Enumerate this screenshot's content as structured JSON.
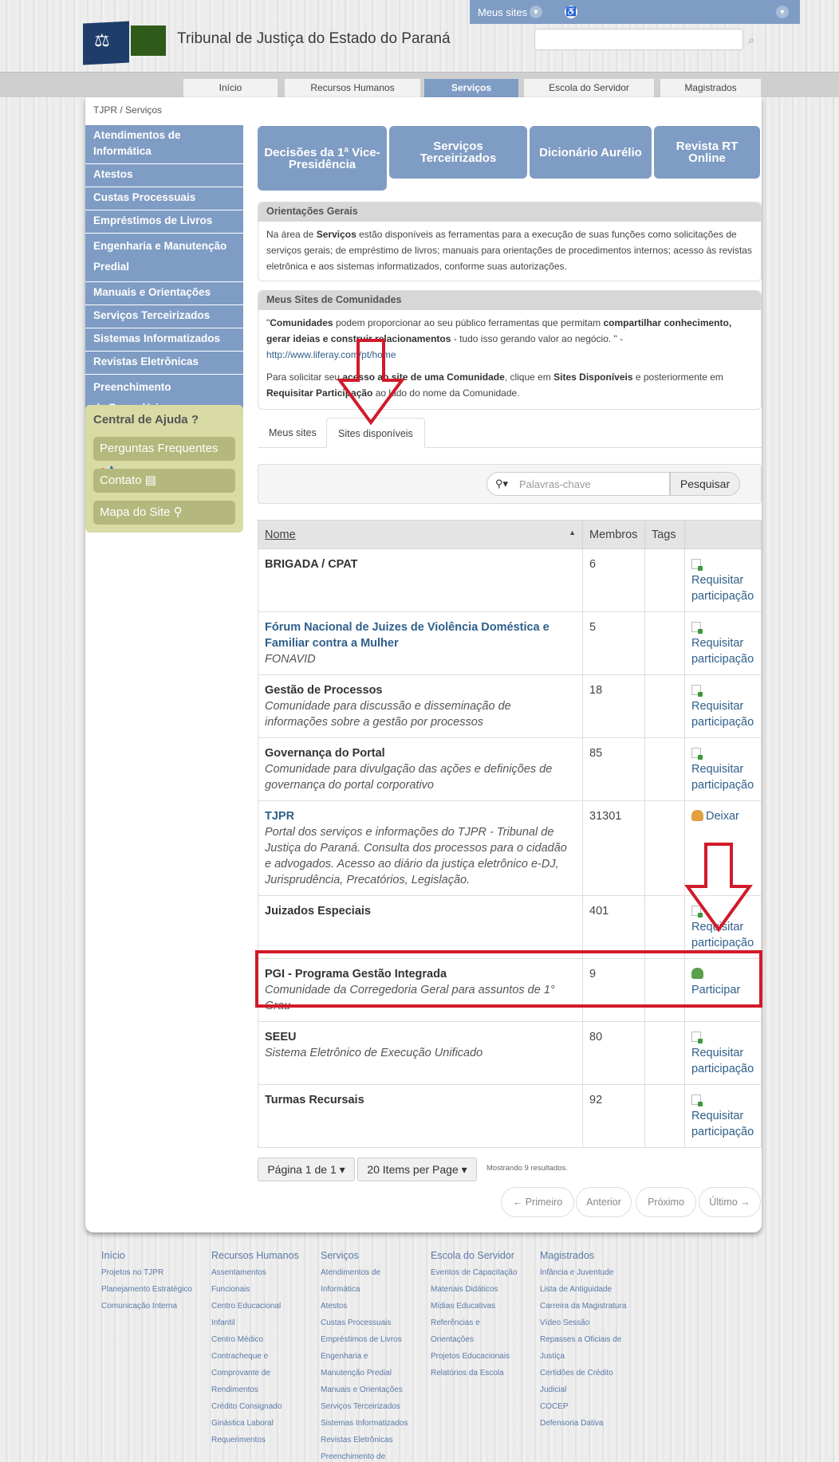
{
  "topbar": {
    "meus_sites": "Meus sites"
  },
  "header": {
    "site_name": "Tribunal de Justiça do Estado do Paraná"
  },
  "nav": {
    "items": [
      "Início",
      "Recursos Humanos",
      "Serviços",
      "Escola do Servidor",
      "Magistrados"
    ],
    "active": "Serviços"
  },
  "breadcrumb": {
    "root": "TJPR",
    "sep": "/",
    "current": "Serviços"
  },
  "sidebar": {
    "items": [
      "Atendimentos de Informática",
      "Atestos",
      "Custas Processuais",
      "Empréstimos de Livros",
      "Engenharia e Manutenção Predial",
      "Manuais e Orientações",
      "Serviços Terceirizados",
      "Sistemas Informatizados",
      "Revistas Eletrônicas",
      "Preenchimento de Formulários"
    ]
  },
  "help": {
    "title": "Central de Ajuda",
    "faq": "Perguntas Frequentes",
    "contact": "Contato",
    "sitemap": "Mapa do Site"
  },
  "service_buttons": [
    "Decisões da 1ª Vice-Presidência",
    "Serviços Terceirizados",
    "Dicionário Aurélio",
    "Revista RT Online"
  ],
  "orientacoes": {
    "title": "Orientações Gerais",
    "t1": "Na área de ",
    "b1": "Serviços",
    "t2": " estão disponíveis as ferramentas para a execução de suas funções como solicitações de serviços gerais; de empréstimo de livros; manuais para orientações de procedimentos internos; acesso às revistas eletrônica  e aos sistemas informatizados, conforme suas autorizações."
  },
  "comunidades": {
    "title": "Meus Sites de Comunidades",
    "q": "\"",
    "b1": "Comunidades",
    "t1": " podem proporcionar ao seu público ferramentas que permitam ",
    "b2": "compartilhar conhecimento, gerar ideias e construir relacionamentos",
    "t2": " - tudo isso gerando valor ao negócio. \" - ",
    "link": "http://www.liferay.com/pt/home",
    "p2a": "Para solicitar seu ",
    "p2b": "acesso ao site de uma Comunidade",
    "p2c": ", clique em ",
    "p2d": "Sites Disponíveis",
    "p2e": " e posteriormente em ",
    "p2f": "Requisitar Participação",
    "p2g": " ao lado do nome da Comunidade."
  },
  "tabs": {
    "meus_sites": "Meus sites",
    "sites_disponiveis": "Sites disponíveis"
  },
  "search": {
    "placeholder": "Palavras-chave",
    "button": "Pesquisar"
  },
  "table": {
    "headers": {
      "nome": "Nome",
      "membros": "Membros",
      "tags": "Tags"
    },
    "rows": [
      {
        "name": "BRIGADA / CPAT",
        "desc": "",
        "members": "6",
        "action": "Requisitar participação"
      },
      {
        "name": "Fórum Nacional de Juizes de Violência Doméstica e Familiar contra a Mulher",
        "desc": "FONAVID",
        "members": "5",
        "action": "Requisitar participação"
      },
      {
        "name": "Gestão de Processos",
        "desc": "Comunidade para discussão e disseminação de informações sobre a gestão por processos",
        "members": "18",
        "action": "Requisitar participação"
      },
      {
        "name": "Governança do Portal",
        "desc": "Comunidade para divulgação das ações e definições de governança do portal corporativo",
        "members": "85",
        "action": "Requisitar participação"
      },
      {
        "name": "TJPR",
        "desc": "Portal dos serviços e informações do TJPR - Tribunal de Justiça do Paraná. Consulta dos processos para o cidadão e advogados. Acesso ao diário da justiça eletrônico e-DJ, Jurisprudência, Precatórios, Legislação.",
        "members": "31301",
        "action": "Deixar"
      },
      {
        "name": "Juizados Especiais",
        "desc": "",
        "members": "401",
        "action": "Requisitar participação"
      },
      {
        "name": "PGI - Programa Gestão Integrada",
        "desc": "Comunidade da Corregedoria Geral para assuntos de 1° Grau",
        "members": "9",
        "action": "Participar"
      },
      {
        "name": "SEEU",
        "desc": "Sistema Eletrônico de Execução Unificado",
        "members": "80",
        "action": "Requisitar participação"
      },
      {
        "name": "Turmas Recursais",
        "desc": "",
        "members": "92",
        "action": "Requisitar participação"
      }
    ]
  },
  "pagination": {
    "page": "Página 1 de 1",
    "per_page": "20 Items per Page",
    "results": "Mostrando 9 resultados.",
    "first": "← Primeiro",
    "prev": "Anterior",
    "next": "Próximo",
    "last": "Último →"
  },
  "footer": [
    {
      "title": "Início",
      "links": [
        "Projetos no TJPR",
        "Planejamento Estratégico",
        "Comunicação Interna"
      ]
    },
    {
      "title": "Recursos Humanos",
      "links": [
        "Assentamentos",
        "Funcionais",
        "Centro Educacional",
        "Infantil",
        "Centro Médico",
        "Contracheque e",
        "Comprovante de",
        "Rendimentos",
        "Crédito Consignado",
        "Ginástica Laboral",
        "Requerimentos"
      ]
    },
    {
      "title": "Serviços",
      "links": [
        "Atendimentos de",
        "Informática",
        "Atestos",
        "Custas Processuais",
        "Empréstimos de Livros",
        "Engenharia e",
        "Manutenção Predial",
        "Manuais e Orientações",
        "Serviços Terceirizados",
        "Sistemas Informatizados",
        "Revistas Eletrônicas",
        "Preenchimento de"
      ]
    },
    {
      "title": "Escola do Servidor",
      "links": [
        "Eventos de Capacitação",
        "Materiais Didáticos",
        "Mídias Educativas",
        "Referências e",
        "Orientações",
        "Projetos Educacionais",
        "Relatórios da Escola"
      ]
    },
    {
      "title": "Magistrados",
      "links": [
        "Infância e Juventude",
        "Lista de Antiguidade",
        "Carreira da Magistratura",
        "Vídeo Sessão",
        "Repasses a Oficiais de",
        "Justiça",
        "Certidões de Crédito",
        "Judicial",
        "COCEP",
        "Defensoria Dativa"
      ]
    }
  ],
  "colors": {
    "brand_blue": "#7f9cc4",
    "help_bg": "#d8dba4",
    "help_btn": "#b4b87c",
    "annotation_red": "#d11a2a"
  }
}
